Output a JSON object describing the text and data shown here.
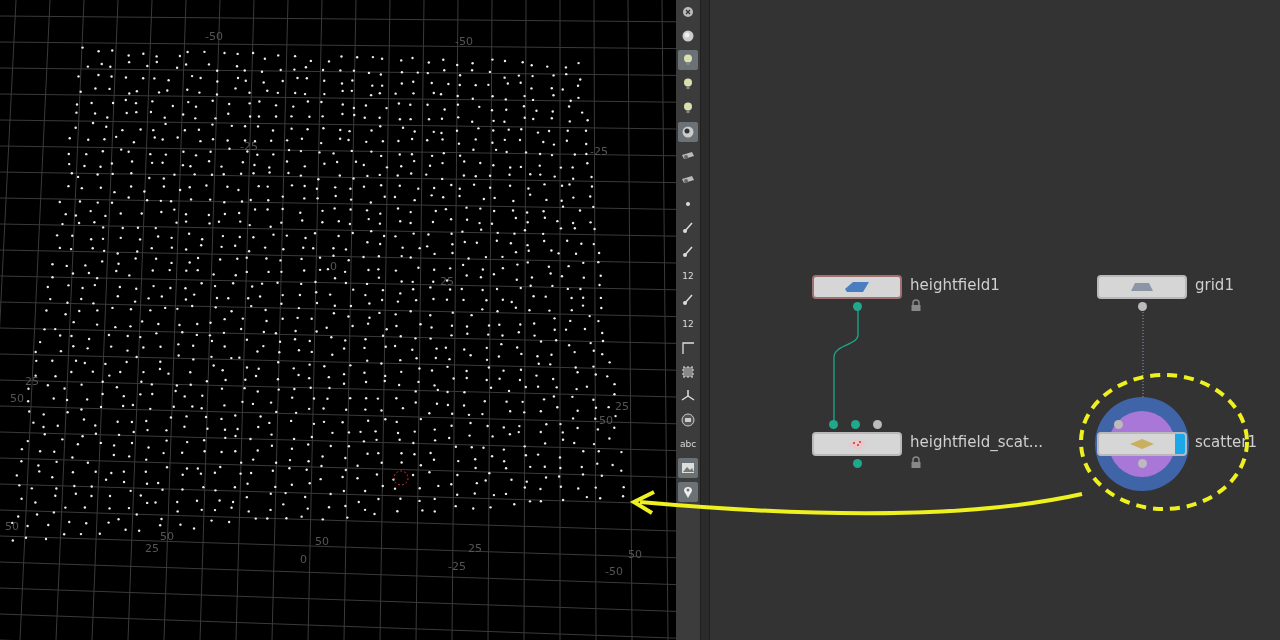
{
  "viewport": {
    "grid_labels": [
      "50",
      "25",
      "50",
      "0",
      "50",
      "25",
      "-25",
      "50",
      "-50",
      "25",
      "-50",
      "25",
      "50",
      "-50",
      "-25",
      "0",
      "25",
      "-50",
      "-25"
    ]
  },
  "toolbar": {
    "tools": [
      {
        "kind": "close",
        "selected": false
      },
      {
        "kind": "sphere",
        "selected": false
      },
      {
        "kind": "bulb",
        "selected": true
      },
      {
        "kind": "bulb",
        "selected": false
      },
      {
        "kind": "bulb",
        "selected": false
      },
      {
        "kind": "ball",
        "selected": true
      },
      {
        "kind": "eye",
        "selected": false
      },
      {
        "kind": "eye",
        "selected": false
      },
      {
        "kind": "dot",
        "selected": false
      },
      {
        "kind": "pen",
        "selected": false
      },
      {
        "kind": "pen",
        "selected": false
      },
      {
        "kind": "number",
        "label": "12",
        "selected": false
      },
      {
        "kind": "pen",
        "selected": false
      },
      {
        "kind": "number",
        "label": "12",
        "selected": false
      },
      {
        "kind": "corner",
        "selected": false
      },
      {
        "kind": "box",
        "selected": false
      },
      {
        "kind": "axes",
        "selected": false
      },
      {
        "kind": "disc",
        "selected": false
      },
      {
        "kind": "text",
        "label": "abc",
        "selected": false
      },
      {
        "kind": "picture",
        "selected": true
      },
      {
        "kind": "pin",
        "selected": true
      }
    ]
  },
  "network": {
    "nodes": [
      {
        "name": "heightfield1",
        "kind": "heightfield",
        "selected": true,
        "locked": true,
        "display": false
      },
      {
        "name": "grid1",
        "kind": "grid",
        "selected": false,
        "locked": false,
        "display": false
      },
      {
        "name": "heightfield_scat...",
        "kind": "scatter_hf",
        "selected": false,
        "locked": true,
        "display": false
      },
      {
        "name": "scatter1",
        "kind": "scatter",
        "selected": false,
        "locked": false,
        "display": true
      }
    ]
  }
}
